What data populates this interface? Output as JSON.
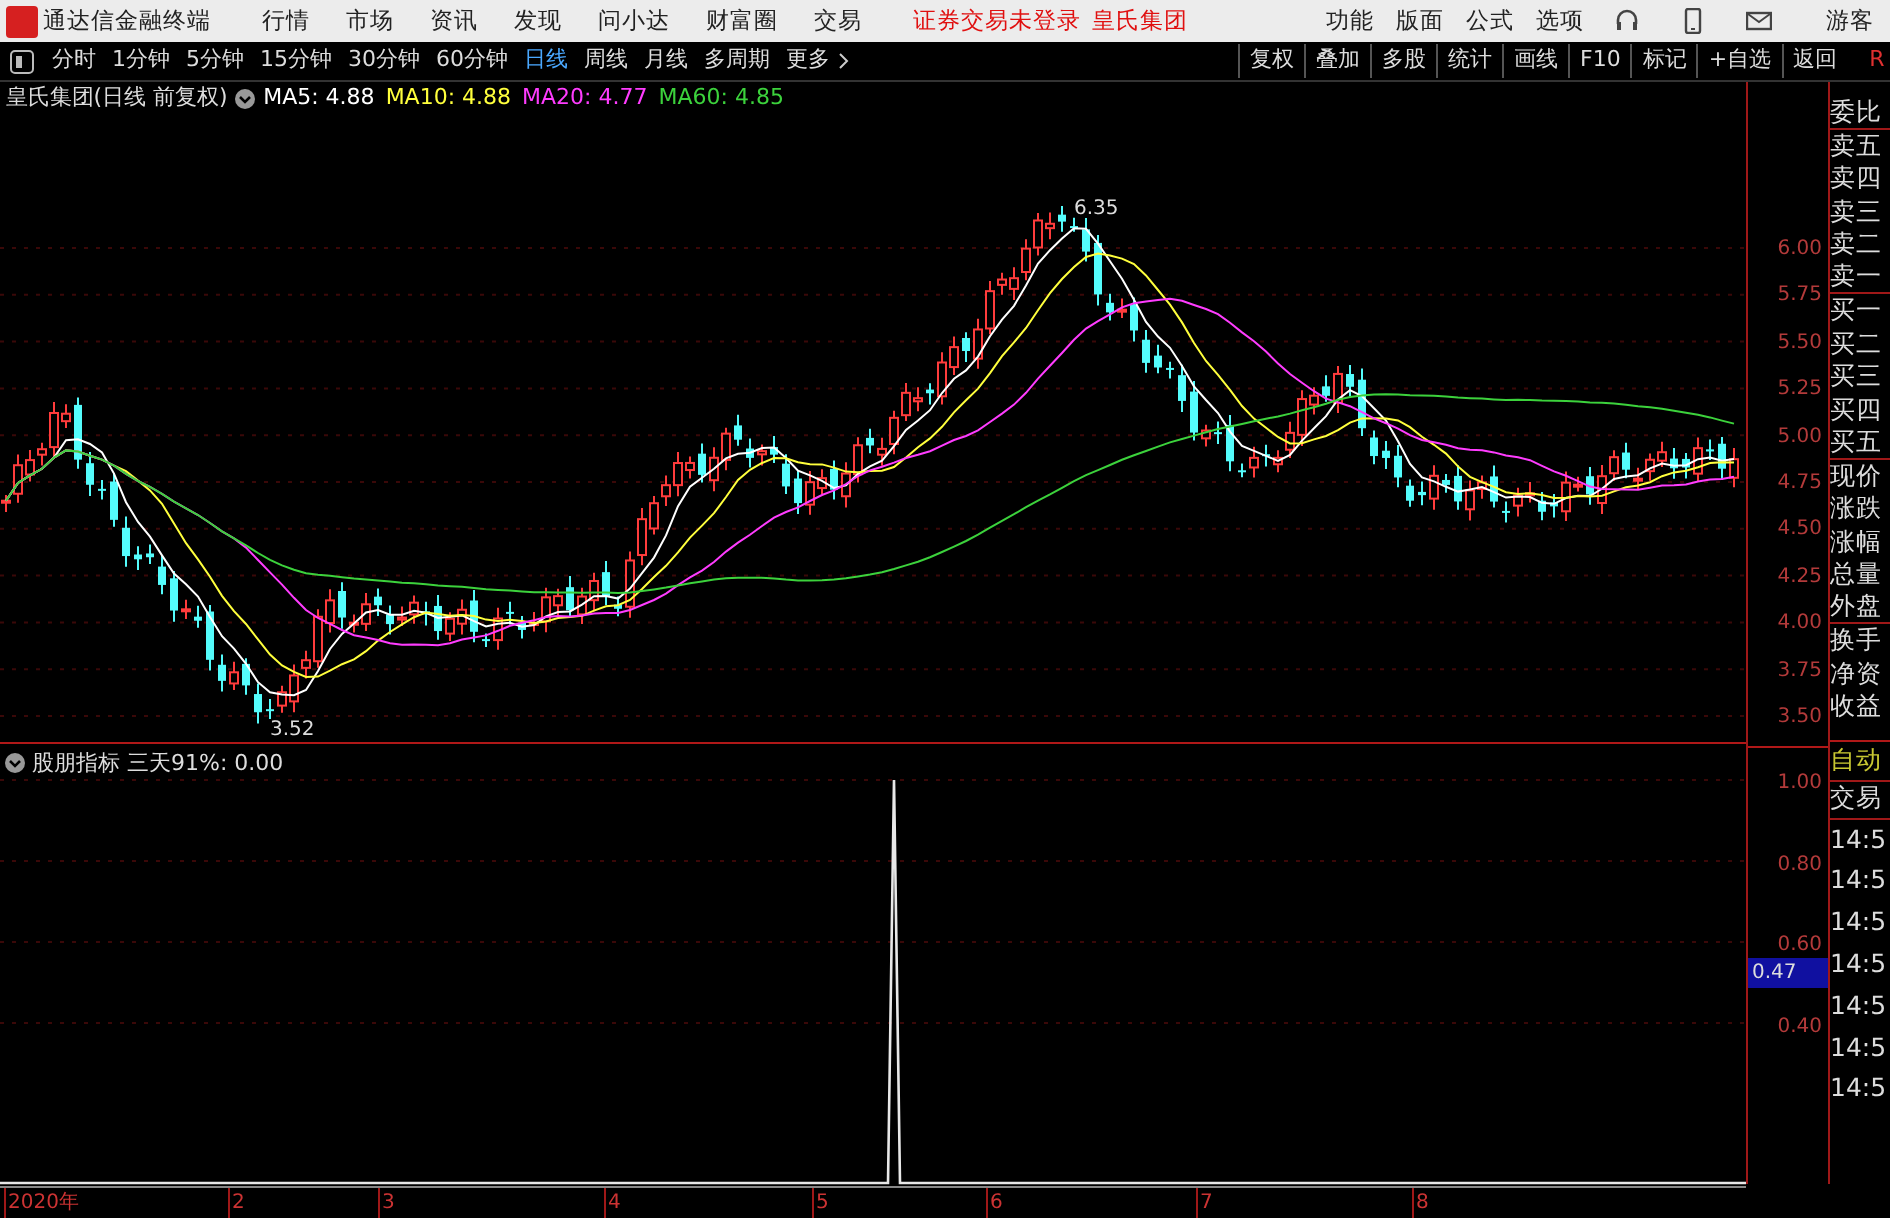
{
  "title_bar": {
    "app_title": "通达信金融终端",
    "menus": [
      "行情",
      "市场",
      "资讯",
      "发现",
      "问小达",
      "财富圈",
      "交易"
    ],
    "notices": [
      "证券交易未登录",
      "皇氏集团"
    ],
    "right_menus": [
      "功能",
      "版面",
      "公式",
      "选项"
    ],
    "user": "游客"
  },
  "toolbar": {
    "periods": [
      {
        "label": "分时",
        "selected": false
      },
      {
        "label": "1分钟",
        "selected": false
      },
      {
        "label": "5分钟",
        "selected": false
      },
      {
        "label": "15分钟",
        "selected": false
      },
      {
        "label": "30分钟",
        "selected": false
      },
      {
        "label": "60分钟",
        "selected": false
      },
      {
        "label": "日线",
        "selected": true
      },
      {
        "label": "周线",
        "selected": false
      },
      {
        "label": "月线",
        "selected": false
      },
      {
        "label": "多周期",
        "selected": false
      },
      {
        "label": "更多",
        "selected": false
      }
    ],
    "buttons": [
      "复权",
      "叠加",
      "多股",
      "统计",
      "画线",
      "F10",
      "标记",
      "+自选",
      "返回"
    ],
    "corner": "R"
  },
  "chart_header": {
    "title": "皇氏集团(日线 前复权)",
    "indicators": [
      {
        "label": "MA5: 4.88",
        "color": "#ffffff"
      },
      {
        "label": "MA10: 4.88",
        "color": "#ffff3c"
      },
      {
        "label": "MA20: 4.77",
        "color": "#ff3cff"
      },
      {
        "label": "MA60: 4.85",
        "color": "#3cd23c"
      }
    ]
  },
  "price_axis": {
    "ticks": [
      "6.00",
      "5.75",
      "5.50",
      "5.25",
      "5.00",
      "4.75",
      "4.50",
      "4.25",
      "4.00",
      "3.75",
      "3.50"
    ]
  },
  "annotations": {
    "high": "6.35",
    "low": "3.52"
  },
  "indicator_panel": {
    "title": "股朋指标 三天91%: 0.00",
    "ticks": [
      "1.00",
      "0.80",
      "0.60",
      "0.40"
    ],
    "cursor_value": "0.47"
  },
  "time_axis": {
    "labels": [
      "2020年",
      "2",
      "3",
      "4",
      "5",
      "6",
      "7",
      "8"
    ]
  },
  "quote_panel": {
    "labels": [
      "委比",
      "卖五",
      "卖四",
      "卖三",
      "卖二",
      "卖一",
      "买一",
      "买二",
      "买三",
      "买四",
      "买五",
      "现价",
      "涨跌",
      "涨幅",
      "总量",
      "外盘",
      "换手",
      "净资",
      "收益"
    ],
    "auto_label": "自动",
    "trade_label": "交易",
    "times": [
      "14:5",
      "14:5",
      "14:5",
      "14:5",
      "14:5",
      "14:5",
      "14:5"
    ]
  }
}
